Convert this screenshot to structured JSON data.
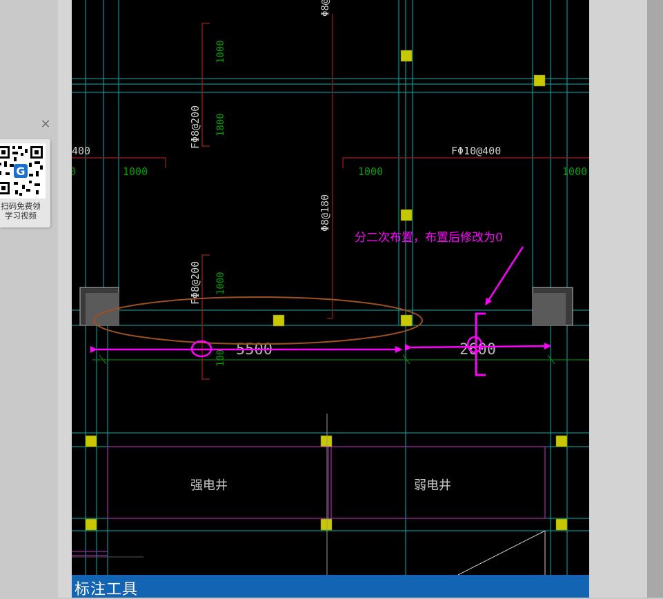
{
  "drawing": {
    "rebar_labels": {
      "f_phi8_200_upper": "FΦ8@200",
      "f_phi8_200_lower": "FΦ8@200",
      "f_phi10_400": "FΦ10@400",
      "f_partial_400": "400",
      "phi8_180": "Φ8@180",
      "phi8_top": "Φ8@"
    },
    "lengths": {
      "len_1000_left_upper": "1000",
      "len_1800": "1800",
      "len_1000_a": "1000",
      "len_1000_b": "1000",
      "len_1000_c": "1000",
      "len_1000_lower": "1000",
      "len_partial_left": "0",
      "len_partial_lower": "100"
    },
    "dimensions": {
      "span_left": "5500",
      "span_right": "2600"
    },
    "annotation": "分二次布置，布置后修改为0",
    "rooms": {
      "strong_shaft": "强电井",
      "weak_shaft": "弱电井"
    },
    "colors": {
      "axis_line": "#00b4b4",
      "rebar_line": "#a01e1e",
      "rebar_text_green": "#00a000",
      "column": "#c8c800",
      "markup": "#ff00ff",
      "ellipse": "#a0501e",
      "wall_line": "#cc33cc"
    }
  },
  "statusbar": {
    "title": "标注工具"
  },
  "qr_popup": {
    "close_icon": "close-icon",
    "line1": "扫码免费领",
    "line2": "学习视频"
  }
}
